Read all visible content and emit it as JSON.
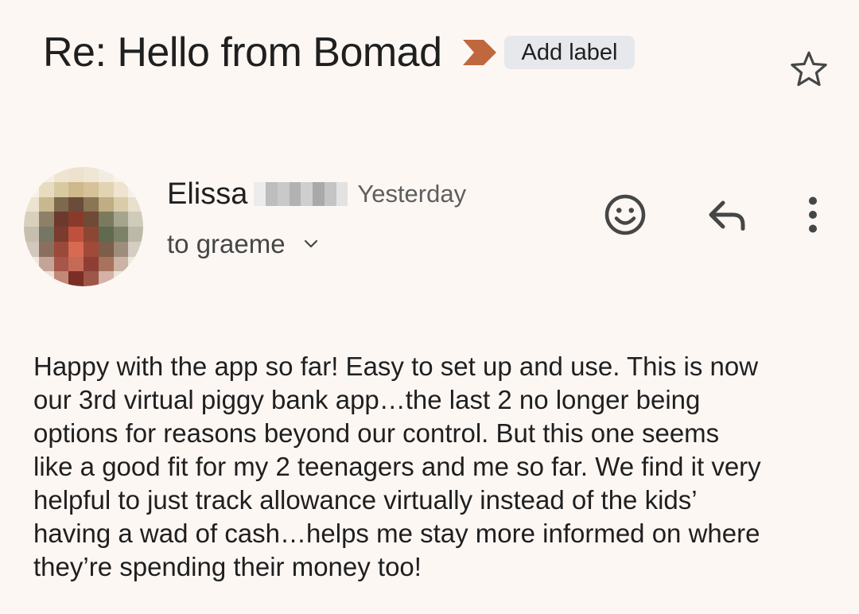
{
  "email": {
    "subject": "Re: Hello from Bomad",
    "label_button": "Add label",
    "sender_name": "Elissa",
    "time": "Yesterday",
    "recipient": "to graeme",
    "body": "Happy with the app so far! Easy to set up and use. This is now\nour 3rd virtual piggy bank app…the last 2 no longer being\noptions for reasons beyond our control. But this one seems\nlike a good fit for my 2 teenagers and me so far. We find it very\nhelpful to just track allowance virtually instead of the kids’\nhaving a wad of cash…helps me stay more informed on where\nthey’re spending their money too!"
  },
  "icons": {
    "importance": "importance-marker-icon",
    "star": "star-icon",
    "emoji": "emoji-reaction-icon",
    "reply": "reply-icon",
    "more": "more-vert-icon",
    "details": "chevron-down-icon"
  },
  "colors": {
    "background": "#fdf7f4",
    "importance": "#c0683d",
    "chip": "#e6e8ec",
    "text": "#1f1f1f",
    "secondary_text": "#5e5e5e"
  }
}
